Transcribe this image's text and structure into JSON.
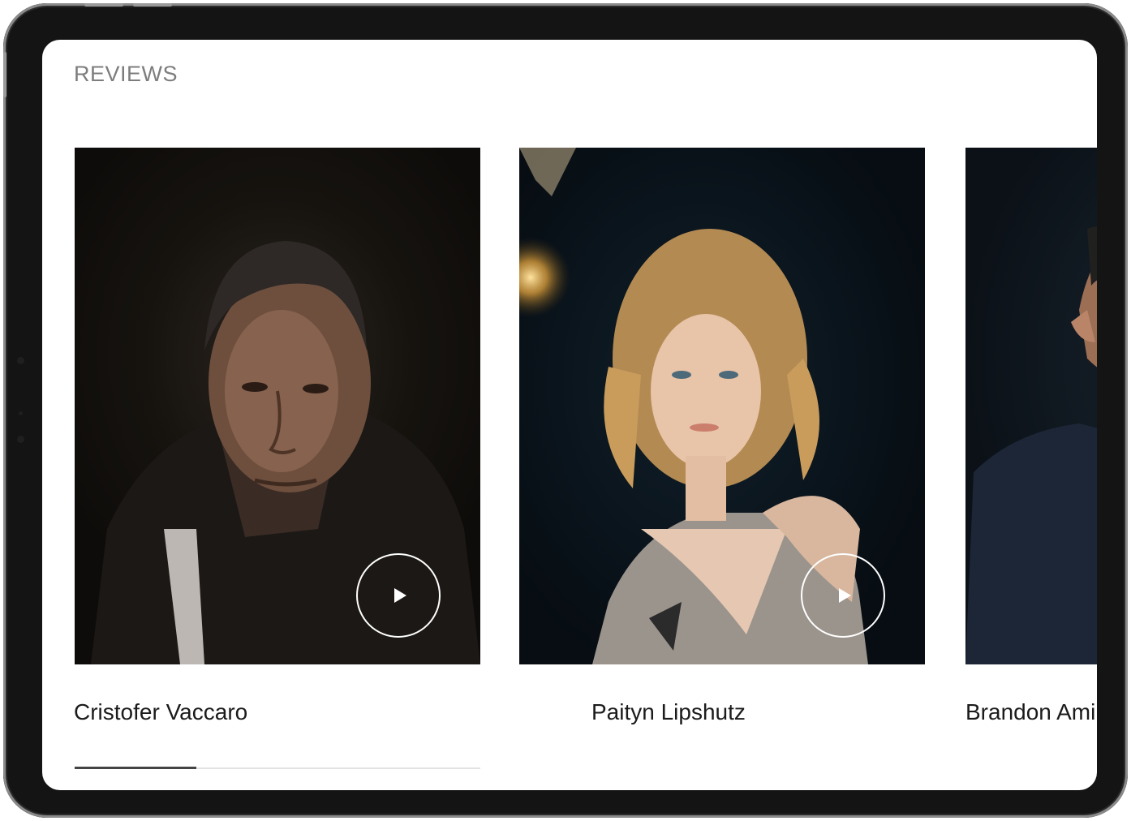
{
  "reviews": {
    "title": "REVIEWS",
    "cards": [
      {
        "name": "Cristofer Vaccaro",
        "play_icon": "play-icon"
      },
      {
        "name": "Paityn Lipshutz",
        "play_icon": "play-icon"
      },
      {
        "name": "Brandon Ami"
      }
    ],
    "progress": 0.3
  },
  "colors": {
    "device_frame": "#141414",
    "screen_bg": "#ffffff",
    "title_text": "#7d7d7d",
    "name_text": "#1b1b1b"
  }
}
